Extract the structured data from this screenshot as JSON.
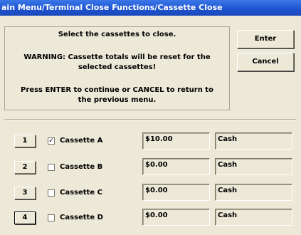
{
  "window": {
    "title": "ain Menu/Terminal Close Functions/Cassette Close"
  },
  "message": {
    "line1": "Select the cassettes to close.",
    "line2": "WARNING: Cassette totals will be reset for the",
    "line3": "selected cassettes!",
    "line4": "Press ENTER to continue or CANCEL to return to",
    "line5": "the previous menu."
  },
  "buttons": {
    "enter": "Enter",
    "cancel": "Cancel"
  },
  "cassettes": [
    {
      "number": "1",
      "checked": true,
      "check_mark": "✓",
      "name": "Cassette A",
      "amount": "$10.00",
      "type": "Cash"
    },
    {
      "number": "2",
      "checked": false,
      "check_mark": "",
      "name": "Cassette B",
      "amount": "$0.00",
      "type": "Cash"
    },
    {
      "number": "3",
      "checked": false,
      "check_mark": "",
      "name": "Cassette C",
      "amount": "$0.00",
      "type": "Cash"
    },
    {
      "number": "4",
      "checked": false,
      "check_mark": "",
      "name": "Cassette D",
      "amount": "$0.00",
      "type": "Cash"
    }
  ]
}
